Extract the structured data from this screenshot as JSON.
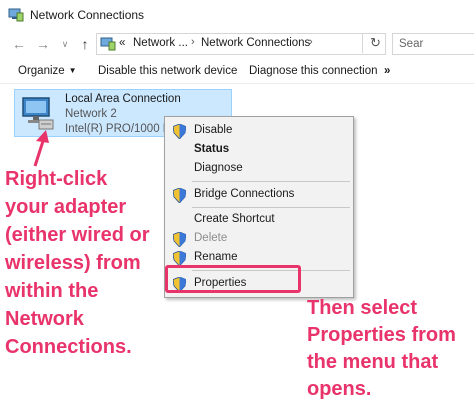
{
  "window": {
    "title": "Network Connections"
  },
  "address_bar": {
    "prefix": "«",
    "crumbs": [
      "Network ...",
      "Network Connections"
    ],
    "search_placeholder": "Sear"
  },
  "toolbar": {
    "organize": "Organize",
    "disable": "Disable this network device",
    "diagnose": "Diagnose this connection",
    "more": "»"
  },
  "adapter": {
    "name": "Local Area Connection",
    "network": "Network  2",
    "device": "Intel(R) PRO/1000 MT"
  },
  "context_menu": {
    "items": [
      {
        "label": "Disable",
        "icon": "shield-icon",
        "style": "normal"
      },
      {
        "label": "Status",
        "icon": "",
        "style": "bold"
      },
      {
        "label": "Diagnose",
        "icon": "",
        "style": "normal"
      },
      {
        "label": "Bridge Connections",
        "icon": "shield-icon",
        "style": "normal"
      },
      {
        "label": "Create Shortcut",
        "icon": "",
        "style": "normal"
      },
      {
        "label": "Delete",
        "icon": "shield-icon",
        "style": "disabled"
      },
      {
        "label": "Rename",
        "icon": "shield-icon",
        "style": "normal"
      },
      {
        "label": "Properties",
        "icon": "shield-icon",
        "style": "normal"
      }
    ]
  },
  "annotations": {
    "left": [
      "Right-click",
      "your adapter",
      "(either wired or",
      "wireless) from",
      "within the",
      "Network",
      "Connections."
    ],
    "right": [
      "Then select",
      "Properties from",
      "the menu that",
      "opens."
    ]
  },
  "colors": {
    "accent": "#e8336b",
    "selection": "#cce8ff",
    "menu_bg": "#f2f2f2"
  }
}
